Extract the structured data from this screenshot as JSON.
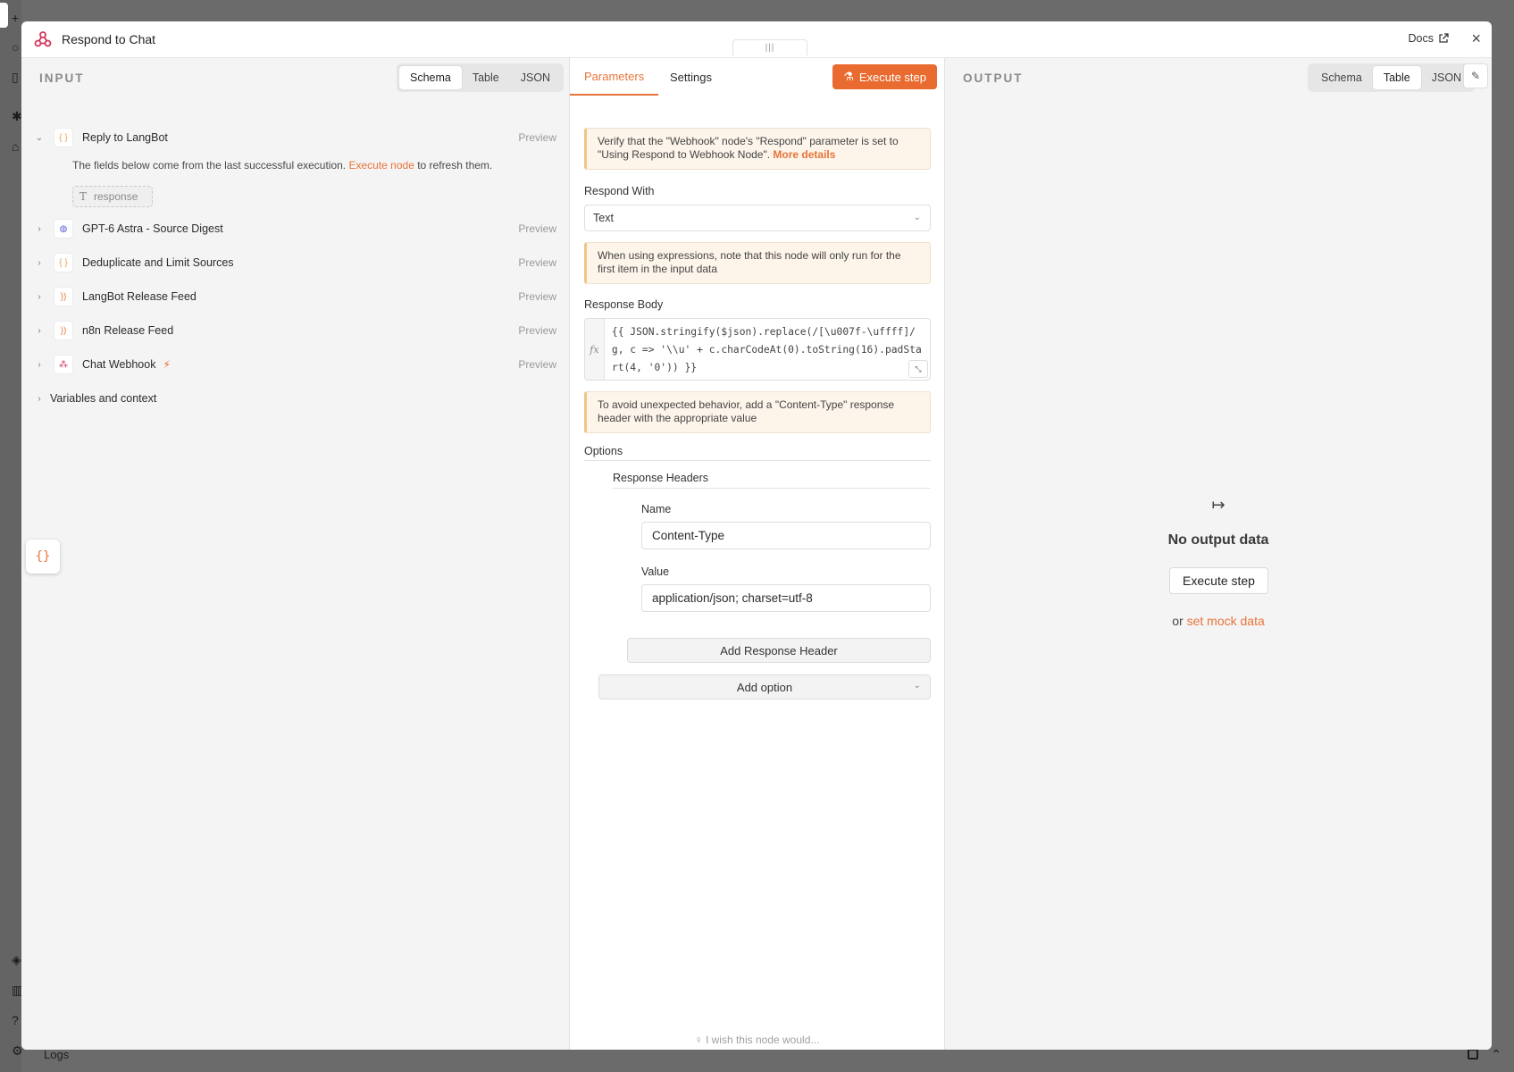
{
  "modal": {
    "title": "Respond to Chat",
    "docs_label": "Docs",
    "close_label": "×",
    "drag_glyph": "|||"
  },
  "input": {
    "panel_label": "INPUT",
    "view_tabs": [
      "Schema",
      "Table",
      "JSON"
    ],
    "active_view": "Schema",
    "nodes": [
      {
        "label": "Reply to LangBot",
        "icon": "code-braces-icon",
        "expanded": true,
        "preview": "Preview"
      },
      {
        "label": "GPT-6 Astra - Source Digest",
        "icon": "globe-icon",
        "expanded": false,
        "preview": "Preview"
      },
      {
        "label": "Deduplicate and Limit Sources",
        "icon": "code-braces-icon",
        "expanded": false,
        "preview": "Preview"
      },
      {
        "label": "LangBot Release Feed",
        "icon": "rss-icon",
        "expanded": false,
        "preview": "Preview"
      },
      {
        "label": "n8n Release Feed",
        "icon": "rss-icon",
        "expanded": false,
        "preview": "Preview"
      },
      {
        "label": "Chat Webhook",
        "icon": "webhook-icon",
        "expanded": false,
        "preview": "Preview",
        "badge": "trigger-bolt-icon"
      }
    ],
    "hint_prefix": "The fields below come from the last successful execution.",
    "hint_link": "Execute node",
    "hint_suffix": "to refresh them.",
    "field_pill_type": "T",
    "field_pill": "response",
    "variables_label": "Variables and context"
  },
  "params": {
    "tabs": [
      "Parameters",
      "Settings"
    ],
    "active_tab": "Parameters",
    "execute_label": "Execute step",
    "notice1_text": "Verify that the \"Webhook\" node's \"Respond\" parameter is set to \"Using Respond to Webhook Node\".",
    "notice1_link": "More details",
    "respond_with_label": "Respond With",
    "respond_with_value": "Text",
    "notice2_text": "When using expressions, note that this node will only run for the first item in the input data",
    "response_body_label": "Response Body",
    "fx_label": "fx",
    "response_body_code": "{{ JSON.stringify($json).replace(/[\\u007f-\\uffff]/g, c => '\\\\u' + c.charCodeAt(0).toString(16).padStart(4, '0')) }}",
    "notice3_text": "To avoid unexpected behavior, add a \"Content-Type\" response header with the appropriate value",
    "options_label": "Options",
    "response_headers_label": "Response Headers",
    "name_label": "Name",
    "name_value": "Content-Type",
    "value_label": "Value",
    "value_value": "application/json; charset=utf-8",
    "add_header_label": "Add Response Header",
    "add_option_label": "Add option",
    "wish_label": "I wish this node would..."
  },
  "output": {
    "panel_label": "OUTPUT",
    "view_tabs": [
      "Schema",
      "Table",
      "JSON"
    ],
    "active_view": "Table",
    "empty_title": "No output data",
    "execute_label": "Execute step",
    "or_label": "or",
    "mock_link": "set mock data"
  },
  "footer": {
    "logs_label": "Logs"
  },
  "colors": {
    "accent": "#ea6b2f",
    "link": "#e8743b",
    "notice_bg": "#fdf4ea",
    "panel_bg": "#f4f4f4"
  }
}
